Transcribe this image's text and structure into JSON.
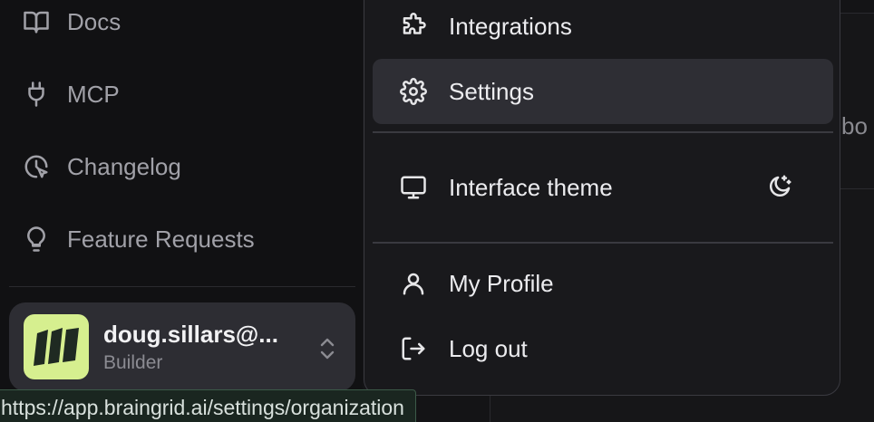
{
  "sidebar": {
    "items": [
      {
        "label": "Docs",
        "icon": "book-open-icon"
      },
      {
        "label": "MCP",
        "icon": "plug-icon"
      },
      {
        "label": "Changelog",
        "icon": "clock-cursor-icon"
      },
      {
        "label": "Feature Requests",
        "icon": "lightbulb-icon"
      }
    ],
    "user": {
      "name": "doug.sillars@...",
      "role": "Builder"
    }
  },
  "menu": {
    "items": [
      {
        "label": "Integrations",
        "icon": "puzzle-icon"
      },
      {
        "label": "Settings",
        "icon": "gear-icon"
      },
      {
        "label": "Interface theme",
        "icon": "monitor-icon"
      },
      {
        "label": "My Profile",
        "icon": "user-icon"
      },
      {
        "label": "Log out",
        "icon": "logout-icon"
      }
    ]
  },
  "background": {
    "partial_text": "bo"
  },
  "status_bar": {
    "url": "https://app.braingrid.ai/settings/organization"
  },
  "colors": {
    "avatar_bg": "#d6ef8f",
    "active_item_bg": "#2e2e34",
    "status_bg": "#1a2620"
  }
}
